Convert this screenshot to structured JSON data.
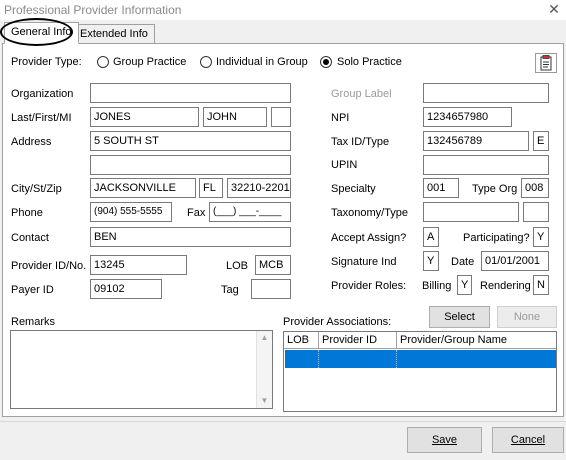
{
  "window": {
    "title": "Professional Provider Information",
    "close_glyph": "✕"
  },
  "tabs": [
    {
      "label": "General Info",
      "active": true
    },
    {
      "label": "Extended Info",
      "active": false
    }
  ],
  "provider_type": {
    "label": "Provider Type:",
    "options": [
      "Group Practice",
      "Individual in Group",
      "Solo Practice"
    ],
    "selected": "Solo Practice"
  },
  "icons": {
    "clipboard": "clipboard-icon"
  },
  "left": {
    "organization": {
      "label": "Organization",
      "value": ""
    },
    "name": {
      "label": "Last/First/MI",
      "last": "JONES",
      "first": "JOHN",
      "mi": ""
    },
    "address": {
      "label": "Address",
      "line1": "5 SOUTH ST",
      "line2": ""
    },
    "city_st_zip": {
      "label": "City/St/Zip",
      "city": "JACKSONVILLE",
      "state": "FL",
      "zip": "32210-2201"
    },
    "phone": {
      "label": "Phone",
      "value": "(904) 555-5555"
    },
    "fax": {
      "label": "Fax",
      "value": "(___) ___-____"
    },
    "contact": {
      "label": "Contact",
      "value": "BEN"
    },
    "provider_id": {
      "label": "Provider ID/No.",
      "value": "13245"
    },
    "lob": {
      "label": "LOB",
      "value": "MCB"
    },
    "payer_id": {
      "label": "Payer ID",
      "value": "09102"
    },
    "tag": {
      "label": "Tag",
      "value": ""
    }
  },
  "right": {
    "group_label": {
      "label": "Group Label",
      "value": ""
    },
    "npi": {
      "label": "NPI",
      "value": "1234657980"
    },
    "tax_id": {
      "label": "Tax ID/Type",
      "value": "132456789",
      "type": "E"
    },
    "upin": {
      "label": "UPIN",
      "value": ""
    },
    "specialty": {
      "label": "Specialty",
      "value": "001"
    },
    "type_org": {
      "label": "Type Org",
      "value": "008"
    },
    "taxonomy": {
      "label": "Taxonomy/Type",
      "value": "",
      "type": ""
    },
    "accept_assign": {
      "label": "Accept Assign?",
      "value": "A"
    },
    "participating": {
      "label": "Participating?",
      "value": "Y"
    },
    "signature_ind": {
      "label": "Signature Ind",
      "value": "Y"
    },
    "date": {
      "label": "Date",
      "value": "01/01/2001"
    },
    "provider_roles": {
      "label": "Provider Roles:",
      "billing_label": "Billing",
      "billing_value": "Y",
      "rendering_label": "Rendering",
      "rendering_value": "N"
    }
  },
  "remarks": {
    "label": "Remarks",
    "value": ""
  },
  "associations": {
    "label": "Provider Associations:",
    "select_label": "Select",
    "none_label": "None",
    "columns": [
      "LOB",
      "Provider ID",
      "Provider/Group Name"
    ]
  },
  "footer": {
    "save_label": "Save",
    "cancel_label": "Cancel"
  }
}
